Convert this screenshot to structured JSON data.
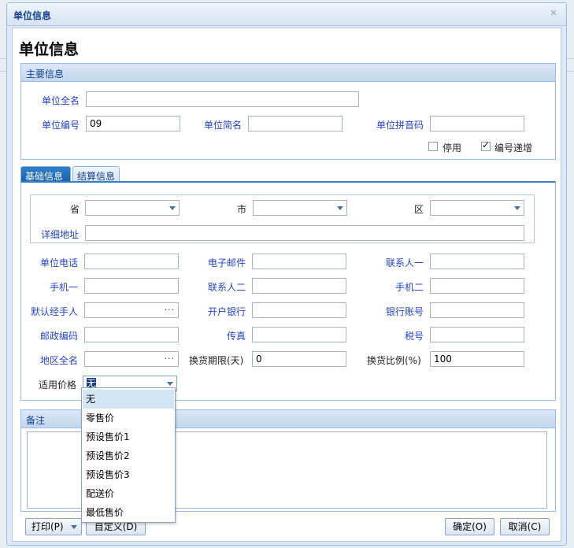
{
  "window": {
    "title": "单位信息"
  },
  "page_title": "单位信息",
  "main_panel": {
    "title": "主要信息",
    "full_name_label": "单位全名",
    "full_name_value": "",
    "code_label": "单位编号",
    "code_value": "09",
    "short_name_label": "单位简名",
    "short_name_value": "",
    "pinyin_label": "单位拼音码",
    "pinyin_value": "",
    "disable_label": "停用",
    "disable_checked": false,
    "auto_inc_label": "编号递增",
    "auto_inc_checked": true
  },
  "tabs": [
    {
      "label": "基础信息",
      "active": true
    },
    {
      "label": "结算信息",
      "active": false
    }
  ],
  "address": {
    "province_label": "省",
    "city_label": "市",
    "district_label": "区",
    "detail_label": "详细地址"
  },
  "fields": {
    "phone": "单位电话",
    "email": "电子邮件",
    "contact1": "联系人一",
    "mobile1": "手机一",
    "contact2": "联系人二",
    "mobile2": "手机二",
    "manager": "默认经手人",
    "bank": "开户银行",
    "account": "银行账号",
    "postcode": "邮政编码",
    "fax": "传真",
    "tax": "税号",
    "region": "地区全名",
    "exchange_days": "换货期限(天)",
    "exchange_days_value": "0",
    "exchange_ratio": "换货比例(%)",
    "exchange_ratio_value": "100",
    "price_label": "适用价格",
    "price_value": "无"
  },
  "remarks": {
    "title": "备注"
  },
  "dropdown_options": [
    "无",
    "零售价",
    "预设售价1",
    "预设售价2",
    "预设售价3",
    "配送价",
    "最低售价"
  ],
  "buttons": {
    "print": "打印(P)",
    "custom": "自定义(D)",
    "ok": "确定(O)",
    "cancel": "取消(C)"
  },
  "icons": {
    "close": "close-icon",
    "dropdown": "chevron-down-icon",
    "ellipsis": "ellipsis-icon"
  }
}
